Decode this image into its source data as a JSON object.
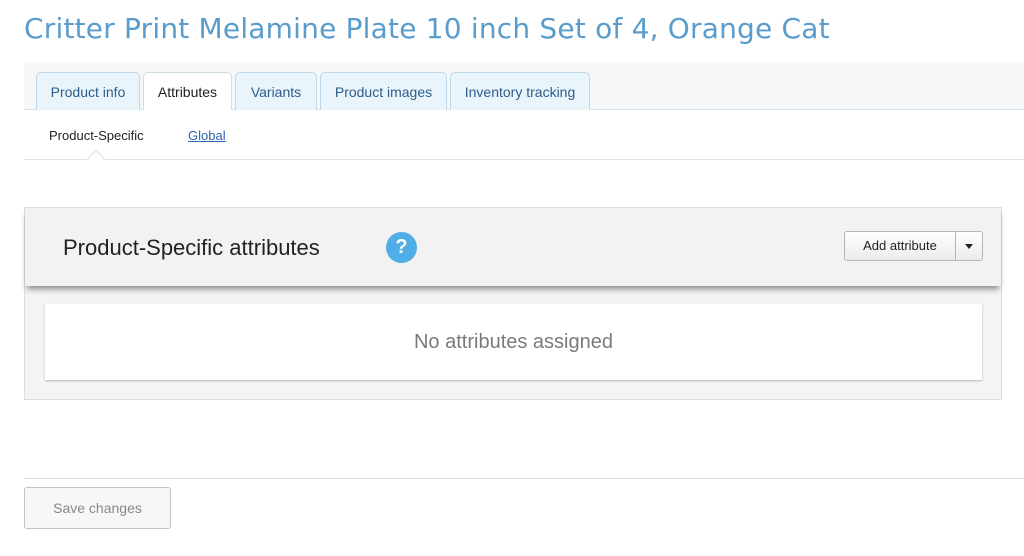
{
  "page": {
    "title": "Critter Print Melamine Plate 10 inch Set of 4, Orange Cat"
  },
  "tabs": [
    {
      "label": "Product info",
      "active": false
    },
    {
      "label": "Attributes",
      "active": true
    },
    {
      "label": "Variants",
      "active": false
    },
    {
      "label": "Product images",
      "active": false
    },
    {
      "label": "Inventory tracking",
      "active": false
    }
  ],
  "subtabs": [
    {
      "label": "Product-Specific",
      "active": true
    },
    {
      "label": "Global",
      "active": false
    }
  ],
  "attributes_panel": {
    "title": "Product-Specific attributes",
    "help_icon_glyph": "?",
    "add_button_label": "Add attribute",
    "empty_message": "No attributes assigned"
  },
  "footer": {
    "save_label": "Save changes"
  },
  "colors": {
    "title": "#5a9ccc",
    "help_icon": "#4faee6",
    "link": "#2f66b3"
  },
  "icons": {
    "help": "help-icon",
    "dropdown": "chevron-down-icon"
  }
}
